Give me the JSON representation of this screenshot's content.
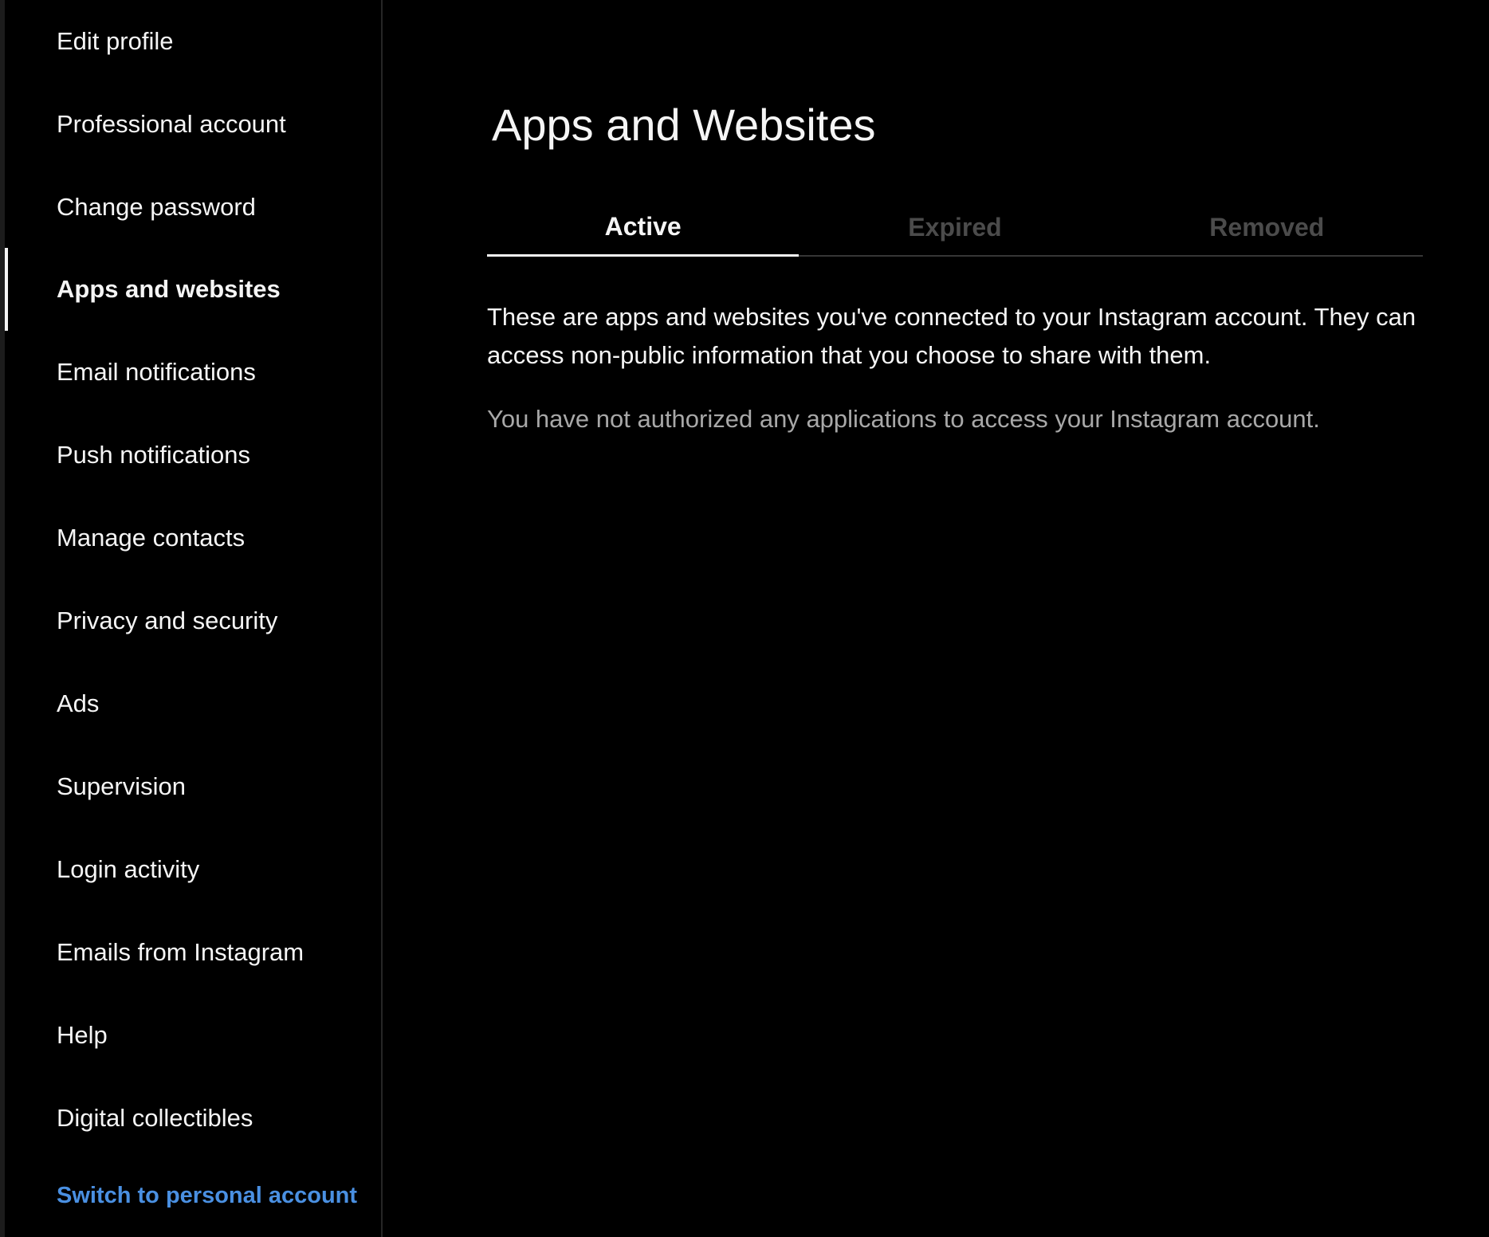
{
  "sidebar": {
    "items": [
      {
        "label": "Edit profile"
      },
      {
        "label": "Professional account"
      },
      {
        "label": "Change password"
      },
      {
        "label": "Apps and websites",
        "active": true
      },
      {
        "label": "Email notifications"
      },
      {
        "label": "Push notifications"
      },
      {
        "label": "Manage contacts"
      },
      {
        "label": "Privacy and security"
      },
      {
        "label": "Ads"
      },
      {
        "label": "Supervision"
      },
      {
        "label": "Login activity"
      },
      {
        "label": "Emails from Instagram"
      },
      {
        "label": "Help"
      },
      {
        "label": "Digital collectibles"
      }
    ],
    "switch_link": "Switch to personal account"
  },
  "main": {
    "title": "Apps and Websites",
    "tabs": [
      {
        "label": "Active",
        "active": true
      },
      {
        "label": "Expired"
      },
      {
        "label": "Removed"
      }
    ],
    "description": "These are apps and websites you've connected to your Instagram account. They can access non-public information that you choose to share with them.",
    "empty_message": "You have not authorized any applications to access your Instagram account."
  },
  "colors": {
    "background": "#000000",
    "text": "#f5f5f5",
    "muted_text": "#a8a8a8",
    "inactive_tab": "#4b4b4b",
    "link": "#4a90e2",
    "divider": "#262626"
  }
}
